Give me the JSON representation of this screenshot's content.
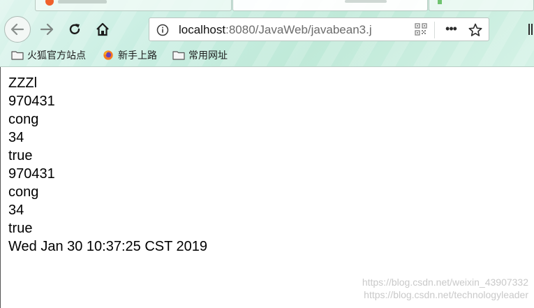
{
  "window": {
    "tabs": [
      {
        "label": ""
      },
      {
        "label": ""
      },
      {
        "label": ""
      }
    ]
  },
  "toolbar": {
    "back_icon": "arrow-left-icon",
    "forward_icon": "arrow-right-icon",
    "reload_icon": "reload-icon",
    "home_icon": "home-icon"
  },
  "urlbar": {
    "host": "localhost",
    "path": ":8080/JavaWeb/javabean3.j",
    "info_icon": "info-icon",
    "qr_icon": "qr-code-icon",
    "more_label": "•••",
    "star_icon": "star-icon"
  },
  "bookmarks": [
    {
      "label": "火狐官方站点",
      "icon": "folder-icon"
    },
    {
      "label": "新手上路",
      "icon": "firefox-icon"
    },
    {
      "label": "常用网址",
      "icon": "folder-icon"
    }
  ],
  "page": {
    "lines": [
      "ZZZl",
      "970431",
      "cong",
      "34",
      "true",
      "970431",
      "cong",
      "34",
      "true",
      "Wed Jan 30 10:37:25 CST 2019"
    ]
  },
  "watermark": {
    "line1": "https://blog.csdn.net/weixin_43907332",
    "line2": "https://blog.csdn.net/technologyleader"
  },
  "colors": {
    "chrome_bg": "#c9eee2",
    "page_bg": "#ffffff",
    "text": "#000000"
  }
}
